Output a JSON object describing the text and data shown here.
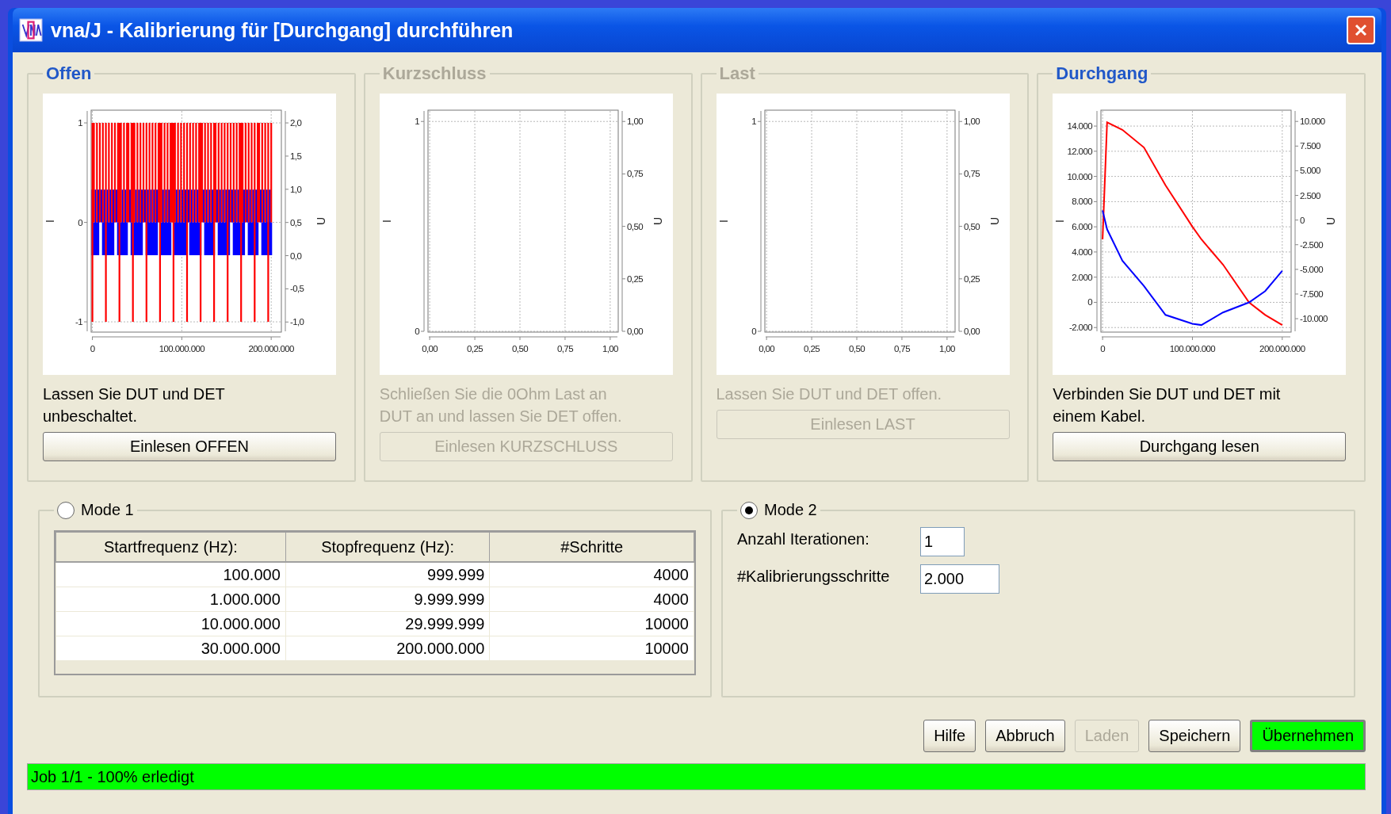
{
  "window": {
    "title": "vna/J - Kalibrierung für [Durchgang] durchführen"
  },
  "panels": [
    {
      "title": "Offen",
      "enabled": true,
      "noise_trace": true,
      "chart_data": {
        "type": "line",
        "grid": true,
        "ylabel": "I",
        "xlim": [
          -500000,
          210500000
        ],
        "ylim": [
          -1.095,
          1.12
        ],
        "xticks": [
          {
            "value": 0,
            "label": "0"
          },
          {
            "value": 100000000,
            "label": "100.000.000"
          },
          {
            "value": 200000000,
            "label": "200.000.000"
          }
        ],
        "yticks": [
          -1,
          0,
          1
        ],
        "y2label": "U",
        "y2lim": [
          -1.14,
          2.18
        ],
        "y2ticks": [
          {
            "value": 2,
            "label": "2,0"
          },
          {
            "value": 1.5,
            "label": "1,5"
          },
          {
            "value": 1,
            "label": "1,0"
          },
          {
            "value": 0.5,
            "label": "0,5"
          },
          {
            "value": 0,
            "label": "0,0"
          },
          {
            "value": -0.5,
            "label": "-0,5"
          },
          {
            "value": -1,
            "label": "-1,0"
          }
        ]
      },
      "instruction": "Lassen Sie DUT und DET unbeschaltet.",
      "button": "Einlesen OFFEN"
    },
    {
      "title": "Kurzschluss",
      "enabled": false,
      "chart_data": {
        "type": "line",
        "grid": true,
        "ylabel": "I",
        "xlim": [
          -0.005,
          1.04
        ],
        "ylim": [
          0,
          1.05
        ],
        "xticks": [
          {
            "value": 0,
            "label": "0,00"
          },
          {
            "value": 0.25,
            "label": "0,25"
          },
          {
            "value": 0.5,
            "label": "0,50"
          },
          {
            "value": 0.75,
            "label": "0,75"
          },
          {
            "value": 1,
            "label": "1,00"
          }
        ],
        "yticks": [
          0,
          1
        ],
        "y2label": "U",
        "y2lim": [
          0,
          1.05
        ],
        "y2ticks": [
          {
            "value": 1,
            "label": "1,00"
          },
          {
            "value": 0.75,
            "label": "0,75"
          },
          {
            "value": 0.5,
            "label": "0,50"
          },
          {
            "value": 0.25,
            "label": "0,25"
          },
          {
            "value": 0,
            "label": "0,00"
          }
        ]
      },
      "instruction": "Schließen Sie die 0Ohm Last an DUT an und lassen Sie DET offen.",
      "button": "Einlesen KURZSCHLUSS"
    },
    {
      "title": "Last",
      "enabled": false,
      "chart_data": {
        "type": "line",
        "grid": true,
        "ylabel": "I",
        "xlim": [
          -0.005,
          1.04
        ],
        "ylim": [
          0,
          1.05
        ],
        "xticks": [
          {
            "value": 0,
            "label": "0,00"
          },
          {
            "value": 0.25,
            "label": "0,25"
          },
          {
            "value": 0.5,
            "label": "0,50"
          },
          {
            "value": 0.75,
            "label": "0,75"
          },
          {
            "value": 1,
            "label": "1,00"
          }
        ],
        "yticks": [
          0,
          1
        ],
        "y2label": "U",
        "y2lim": [
          0,
          1.05
        ],
        "y2ticks": [
          {
            "value": 1,
            "label": "1,00"
          },
          {
            "value": 0.75,
            "label": "0,75"
          },
          {
            "value": 0.5,
            "label": "0,50"
          },
          {
            "value": 0.25,
            "label": "0,25"
          },
          {
            "value": 0,
            "label": "0,00"
          }
        ]
      },
      "instruction": "Lassen Sie DUT und DET offen.",
      "button": "Einlesen LAST"
    },
    {
      "title": "Durchgang",
      "enabled": true,
      "chart_data": {
        "type": "line",
        "grid": true,
        "ylabel": "I",
        "xlim": [
          -1000000,
          209000000
        ],
        "ylim": [
          -2300,
          15200
        ],
        "xticks": [
          {
            "value": 0,
            "label": "0"
          },
          {
            "value": 100000000,
            "label": "100.000.000"
          },
          {
            "value": 200000000,
            "label": "200.000.000"
          }
        ],
        "yticks": [
          {
            "value": 14000,
            "label": "14.000"
          },
          {
            "value": 12000,
            "label": "12.000"
          },
          {
            "value": 10000,
            "label": "10.000"
          },
          {
            "value": 8000,
            "label": "8.000"
          },
          {
            "value": 6000,
            "label": "6.000"
          },
          {
            "value": 4000,
            "label": "4.000"
          },
          {
            "value": 2000,
            "label": "2.000"
          },
          {
            "value": 0,
            "label": "0"
          },
          {
            "value": -2000,
            "label": "-2.000"
          }
        ],
        "y2label": "U",
        "y2lim": [
          -11280,
          11060
        ],
        "y2ticks": [
          {
            "value": 10000,
            "label": "10.000"
          },
          {
            "value": 7500,
            "label": "7.500"
          },
          {
            "value": 5000,
            "label": "5.000"
          },
          {
            "value": 2500,
            "label": "2.500"
          },
          {
            "value": 0,
            "label": "0"
          },
          {
            "value": -2500,
            "label": "-2.500"
          },
          {
            "value": -5000,
            "label": "-5.000"
          },
          {
            "value": -7500,
            "label": "-7.500"
          },
          {
            "value": -10000,
            "label": "-10.000"
          }
        ],
        "x": [
          0,
          5000000,
          22000000,
          46000000,
          70000000,
          100000000,
          110000000,
          134000000,
          163000000,
          181000000,
          200000000
        ],
        "series": [
          {
            "color": "#ff0000",
            "values": [
              5000,
              14300,
              13700,
              12300,
              9300,
              6000,
              5000,
              3000,
              0,
              -1000,
              -1800
            ]
          },
          {
            "color": "#0000ff",
            "values": [
              7300,
              5800,
              3300,
              1300,
              -1000,
              -1700,
              -1800,
              -800,
              0,
              900,
              2500
            ]
          }
        ]
      },
      "instruction": "Verbinden Sie DUT und DET mit einem Kabel.",
      "button": "Durchgang lesen"
    }
  ],
  "modes": [
    {
      "label": "Mode 1",
      "selected": false,
      "kind": "table",
      "table": {
        "columns": [
          "Startfrequenz (Hz):",
          "Stopfrequenz (Hz):",
          "#Schritte"
        ],
        "rows": [
          [
            "100.000",
            "999.999",
            "4000"
          ],
          [
            "1.000.000",
            "9.999.999",
            "4000"
          ],
          [
            "10.000.000",
            "29.999.999",
            "10000"
          ],
          [
            "30.000.000",
            "200.000.000",
            "10000"
          ]
        ]
      }
    },
    {
      "label": "Mode 2",
      "selected": true,
      "kind": "fields",
      "fields": [
        {
          "label": "Anzahl Iterationen:",
          "value": "1"
        },
        {
          "label": "#Kalibrierungsschritte",
          "value": "2.000"
        }
      ]
    }
  ],
  "buttons": [
    {
      "label": "Hilfe",
      "enabled": true,
      "highlighted": false
    },
    {
      "label": "Abbruch",
      "enabled": true,
      "highlighted": false
    },
    {
      "label": "Laden",
      "enabled": false,
      "highlighted": false
    },
    {
      "label": "Speichern",
      "enabled": true,
      "highlighted": false
    },
    {
      "label": "Übernehmen",
      "enabled": true,
      "highlighted": true
    }
  ],
  "status_bar": {
    "text": "Job 1/1 - 100% erledigt",
    "level": 1
  }
}
